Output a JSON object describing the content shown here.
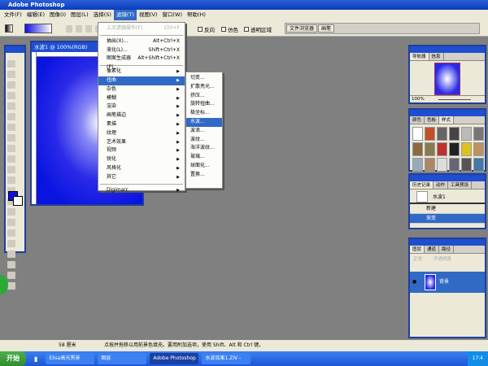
{
  "app": {
    "title": "Adobe Photoshop"
  },
  "menubar": [
    "文件(F)",
    "编辑(E)",
    "图像(I)",
    "图层(L)",
    "选择(S)",
    "滤镜(T)",
    "视图(V)",
    "窗口(W)",
    "帮助(H)"
  ],
  "options": {
    "checkboxes": [
      "反向",
      "仿色",
      "透明区域"
    ],
    "palette_well": [
      "文件浏览器",
      "画笔"
    ],
    "gradient_colors": [
      "#1010e0",
      "#ffffff"
    ]
  },
  "document": {
    "title": "水波1 @ 100%(RGB)"
  },
  "filter_menu": {
    "items": [
      {
        "label": "上次滤镜操作(F)",
        "shortcut": "Ctrl+F",
        "disabled": true
      },
      {
        "sep": true
      },
      {
        "label": "抽出(X)...",
        "shortcut": "Alt+Ctrl+X"
      },
      {
        "label": "液化(L)...",
        "shortcut": "Shift+Ctrl+X"
      },
      {
        "label": "图案生成器(P)...",
        "shortcut": "Alt+Shift+Ctrl+X"
      },
      {
        "sep": true
      },
      {
        "label": "像素化",
        "sub": true
      },
      {
        "label": "扭曲",
        "sub": true,
        "highlighted": true
      },
      {
        "label": "杂色",
        "sub": true
      },
      {
        "label": "模糊",
        "sub": true
      },
      {
        "label": "渲染",
        "sub": true
      },
      {
        "label": "画笔描边",
        "sub": true
      },
      {
        "label": "素描",
        "sub": true
      },
      {
        "label": "纹理",
        "sub": true
      },
      {
        "label": "艺术效果",
        "sub": true
      },
      {
        "label": "视频",
        "sub": true
      },
      {
        "label": "锐化",
        "sub": true
      },
      {
        "label": "风格化",
        "sub": true
      },
      {
        "label": "其它",
        "sub": true
      },
      {
        "sep": true
      },
      {
        "label": "Digimarc",
        "sub": true
      }
    ]
  },
  "distort_submenu": [
    "切变...",
    "扩散亮光...",
    "挤压...",
    "旋转扭曲...",
    "极坐标...",
    "水波...",
    "波浪...",
    "波纹...",
    "海洋波纹...",
    "玻璃...",
    "球面化...",
    "置换..."
  ],
  "distort_selected": "水波...",
  "panels": {
    "navigator": {
      "tabs": [
        "导航器",
        "信息"
      ],
      "zoom": "100%"
    },
    "swatches": {
      "tabs": [
        "颜色",
        "色板",
        "样式"
      ]
    },
    "history": {
      "tabs": [
        "历史记录",
        "动作",
        "工具预设"
      ],
      "snapshot": "水波1",
      "items": [
        "新建",
        "渐变"
      ]
    },
    "layers": {
      "tabs": [
        "图层",
        "通道",
        "路径"
      ],
      "mode": "正常",
      "opacity_label": "不透明度",
      "layer": "背景"
    }
  },
  "status": {
    "zoom": "58 厘米",
    "hint": "点按并拖移以用前景色填充。要用附加选项，使用 Shift、Alt 和 Ctrl 键。"
  },
  "taskbar": {
    "start": "开始",
    "tasks": [
      "Elisa高光黑景",
      "图层",
      "Adobe Photoshop",
      "水波效果1.ZIV -"
    ],
    "active": "Adobe Photoshop",
    "clock": "17:4"
  }
}
